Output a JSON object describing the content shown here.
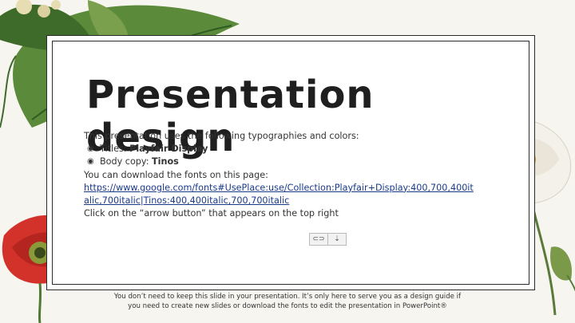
{
  "slide": {
    "title": "Presentation\ndesign",
    "intro": "This presentation uses the following typographies and colors:",
    "bullets": [
      {
        "label": "Titles: ",
        "value": "Playfair Display"
      },
      {
        "label": "Body copy: ",
        "value": "Tinos"
      }
    ],
    "download_text": "You can download the fonts on this page:",
    "link_text": "https://www.google.com/fonts#UsePlace:use/Collection:Playfair+Display:400,700,400italic,700italic|Tinos:400,400italic,700,700italic",
    "arrow_text": "Click on the “arrow button” that appears on the top right",
    "footer_text": "You don’t need to keep this slide in your presentation. It’s only here to serve you as a design guide if you need to create new slides or download the fonts to edit the presentation in PowerPoint®"
  },
  "toolbar": {
    "link_icon_glyph": "⊂⊃",
    "download_icon_glyph": "⇣"
  },
  "colors": {
    "frame_border": "#2a2a2a",
    "link": "#1a3a8a",
    "poppy_red": "#d3322b",
    "leaf_green": "#4f7a35"
  },
  "decorations": [
    "top-left-leaves",
    "left-red-poppy",
    "right-white-poppy",
    "right-bud"
  ]
}
